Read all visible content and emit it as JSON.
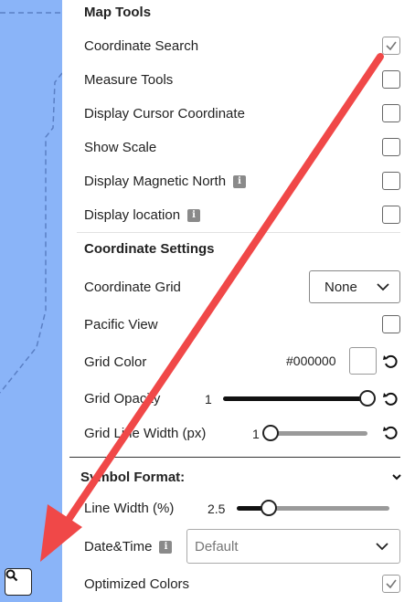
{
  "map_tools": {
    "title": "Map Tools",
    "items": [
      {
        "label": "Coordinate Search",
        "checked": true
      },
      {
        "label": "Measure Tools",
        "checked": false
      },
      {
        "label": "Display Cursor Coordinate",
        "checked": false
      },
      {
        "label": "Show Scale",
        "checked": false
      },
      {
        "label": "Display Magnetic North",
        "checked": false
      },
      {
        "label": "Display location",
        "checked": false
      }
    ]
  },
  "coordinate_settings": {
    "title": "Coordinate Settings",
    "grid_label": "Coordinate Grid",
    "grid_value": "None",
    "pacific_label": "Pacific View",
    "color_label": "Grid Color",
    "color_value": "#000000",
    "opacity_label": "Grid Opacity",
    "opacity_value": "1",
    "width_label": "Grid Line Width (px)",
    "width_value": "1"
  },
  "symbol_format": {
    "title": "Symbol Format:",
    "line_width_label": "Line Width (%)",
    "line_width_value": "2.5",
    "datetime_label": "Date&Time",
    "datetime_value": "Default",
    "optimized_label": "Optimized Colors",
    "optimized_checked": true
  },
  "colors": {
    "annotation_arrow": "#f04848",
    "map_background": "#8ab4f8"
  }
}
